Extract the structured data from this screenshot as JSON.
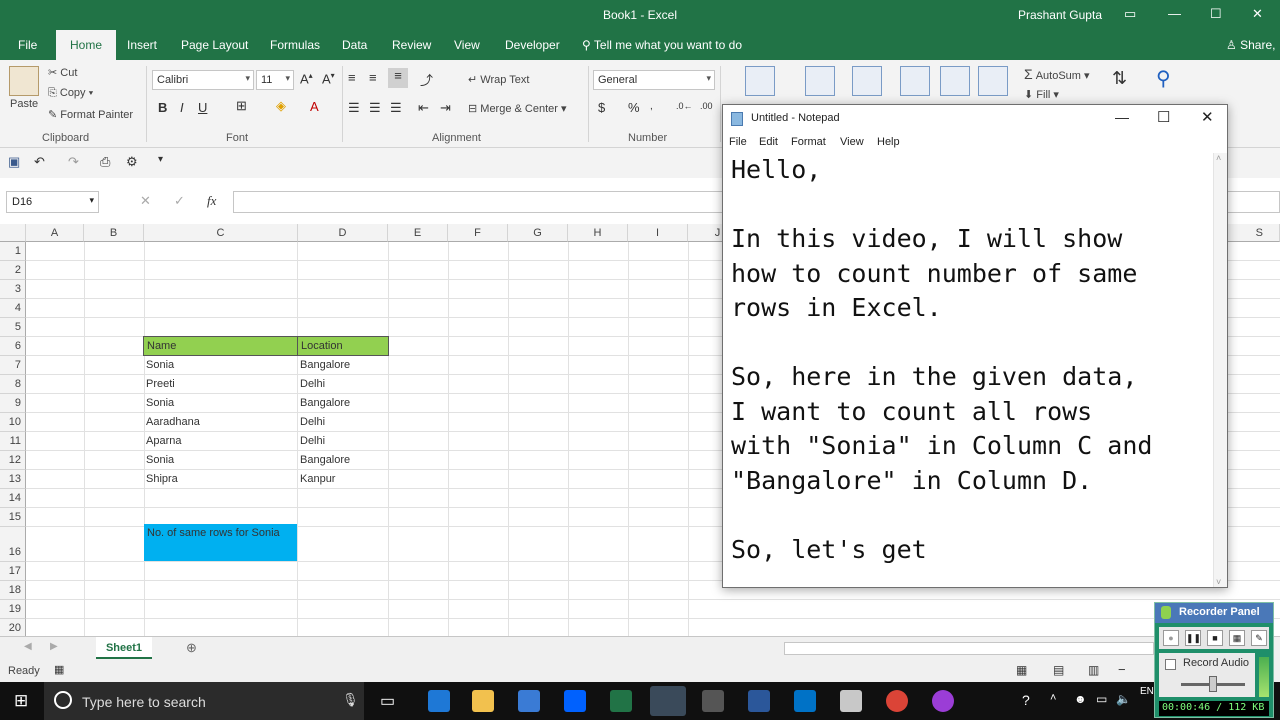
{
  "excel": {
    "title": "Book1 - Excel",
    "user": "Prashant Gupta",
    "share": "Share",
    "tabs": [
      "File",
      "Home",
      "Insert",
      "Page Layout",
      "Formulas",
      "Data",
      "Review",
      "View",
      "Developer"
    ],
    "tell_me": "Tell me what you want to do",
    "ribbon": {
      "paste": "Paste",
      "cut": "Cut",
      "copy": "Copy",
      "format_painter": "Format Painter",
      "clipboard": "Clipboard",
      "font_name": "Calibri",
      "font_size": "11",
      "font": "Font",
      "wrap_text": "Wrap Text",
      "merge_center": "Merge & Center",
      "alignment": "Alignment",
      "number_format": "General",
      "number": "Number",
      "autosum": "AutoSum",
      "fill": "Fill"
    },
    "name_box": "D16",
    "columns": [
      "A",
      "B",
      "C",
      "D",
      "E",
      "F",
      "G",
      "H",
      "I",
      "J",
      "S"
    ],
    "rows": [
      "1",
      "2",
      "3",
      "4",
      "5",
      "6",
      "7",
      "8",
      "9",
      "10",
      "11",
      "12",
      "13",
      "14",
      "15",
      "16",
      "17",
      "18",
      "19",
      "20"
    ],
    "table": {
      "header": [
        "Name",
        "Location"
      ],
      "rows": [
        [
          "Sonia",
          "Bangalore"
        ],
        [
          "Preeti",
          "Delhi"
        ],
        [
          "Sonia",
          "Bangalore"
        ],
        [
          "Aaradhana",
          "Delhi"
        ],
        [
          "Aparna",
          "Delhi"
        ],
        [
          "Sonia",
          "Bangalore"
        ],
        [
          "Shipra",
          "Kanpur"
        ]
      ],
      "summary_label": "No. of same rows for Sonia"
    },
    "sheet_tab": "Sheet1",
    "status": "Ready",
    "colors": {
      "accent": "#217346",
      "header_fill": "#92d050",
      "summary_fill": "#00b0f0"
    }
  },
  "notepad": {
    "title": "Untitled - Notepad",
    "menu": [
      "File",
      "Edit",
      "Format",
      "View",
      "Help"
    ],
    "text": "Hello,\n\nIn this video, I will show\nhow to count number of same\nrows in Excel.\n\nSo, here in the given data,\nI want to count all rows\nwith \"Sonia\" in Column C and\n\"Bangalore\" in Column D.\n\nSo, let's get"
  },
  "taskbar": {
    "search_placeholder": "Type here to search"
  },
  "recorder": {
    "title": "Recorder Panel",
    "record_audio": "Record Audio",
    "time": "00:00:46 / 112 KB"
  }
}
